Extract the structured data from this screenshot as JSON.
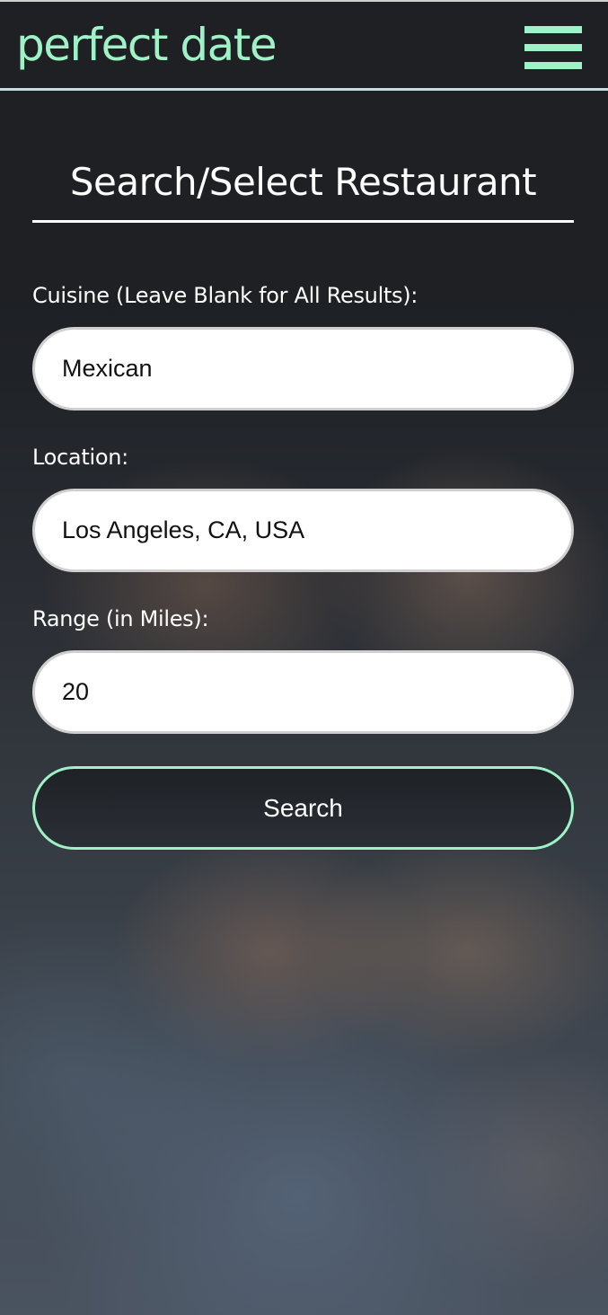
{
  "header": {
    "brand": "perfect date",
    "menu_icon": "hamburger-menu-icon"
  },
  "page": {
    "title": "Search/Select Restaurant"
  },
  "form": {
    "cuisine": {
      "label": "Cuisine (Leave Blank for All Results):",
      "value": "Mexican"
    },
    "location": {
      "label": "Location:",
      "value": "Los Angeles, CA, USA"
    },
    "range": {
      "label": "Range (in Miles):",
      "value": "20"
    },
    "search_label": "Search"
  },
  "colors": {
    "accent": "#9ff2c8",
    "header_bg": "#1e2024",
    "header_border": "#c7dde6",
    "text": "#ffffff"
  }
}
